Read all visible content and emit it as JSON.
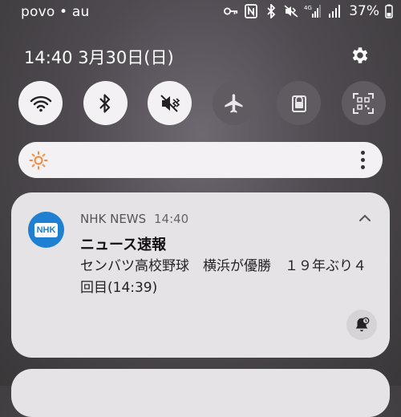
{
  "status_bar": {
    "carrier": "povo • au",
    "icons": [
      "key-icon",
      "nfc-icon",
      "bluetooth-icon",
      "mute-icon",
      "signal-4g-icon",
      "signal-icon"
    ],
    "network_label": "4G",
    "battery": "37%"
  },
  "header": {
    "datetime": "14:40  3月30日(日)"
  },
  "quick_settings": [
    {
      "name": "wifi",
      "state": "on"
    },
    {
      "name": "bluetooth",
      "state": "on"
    },
    {
      "name": "sound-mute",
      "state": "on"
    },
    {
      "name": "airplane-mode",
      "state": "off"
    },
    {
      "name": "lock",
      "state": "off"
    },
    {
      "name": "qr-scanner",
      "state": "off"
    }
  ],
  "brightness": {
    "icon": "sun-icon"
  },
  "notification": {
    "app_name": "NHK NEWS",
    "time": "14:40",
    "app_icon_text": "NHK",
    "title": "ニュース速報",
    "body": "センバツ高校野球　横浜が優勝　１９年ぶり４回目(14:39)"
  },
  "colors": {
    "tile_on": "#f3f1f4",
    "tile_off": "#5f5b60",
    "nhk_blue": "#1f7fd0",
    "sun_orange": "#f28a3c"
  }
}
